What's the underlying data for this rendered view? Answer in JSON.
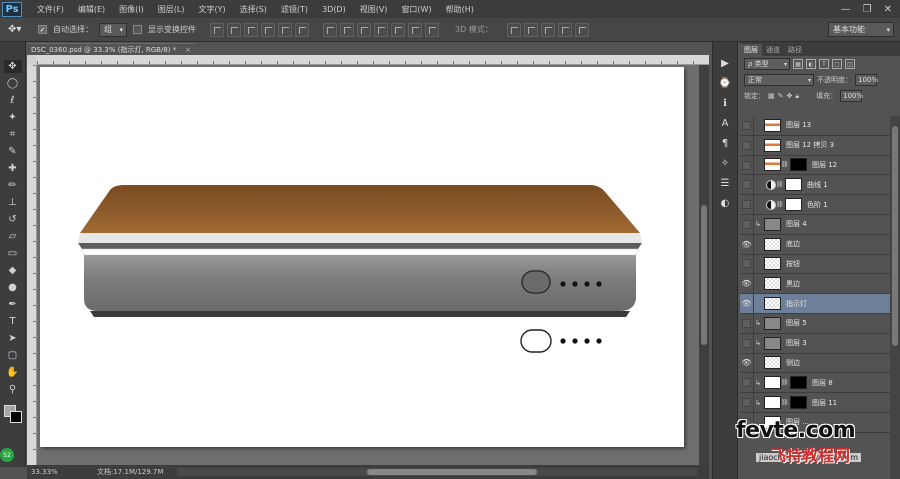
{
  "app": {
    "logo": "Ps"
  },
  "menu": [
    "文件(F)",
    "编辑(E)",
    "图像(I)",
    "图层(L)",
    "文字(Y)",
    "选择(S)",
    "滤镜(T)",
    "3D(D)",
    "视图(V)",
    "窗口(W)",
    "帮助(H)"
  ],
  "window_controls": {
    "minimize": "—",
    "restore": "❐",
    "close": "✕"
  },
  "options": {
    "auto_select_label": "自动选择：",
    "auto_select_checked": true,
    "auto_select_value": "组",
    "show_transform_label": "显示变换控件",
    "show_transform_checked": false,
    "mode_3d_label": "3D 模式：",
    "workspace": "基本功能"
  },
  "document": {
    "tab_title": "DSC_0360.psd @ 33.3% (指示灯, RGB/8) *",
    "tab_close": "×"
  },
  "status": {
    "zoom": "33.33%",
    "doc_size": "文档:17.1M/129.7M"
  },
  "tools_badge": "52",
  "layers_panel": {
    "tabs": [
      "图层",
      "通道",
      "路径"
    ],
    "filter_kind": "ρ 类型",
    "blend_mode": "正常",
    "opacity_label": "不透明度：",
    "opacity_value": "100%",
    "lock_label": "锁定：",
    "fill_label": "填充：",
    "fill_value": "100%",
    "layers": [
      {
        "name": "图层 13",
        "visible": false,
        "clip": false,
        "thumb": "orange",
        "mask": null,
        "selected": false
      },
      {
        "name": "图层 12 拷贝 3",
        "visible": false,
        "clip": false,
        "thumb": "orange",
        "mask": null,
        "selected": false
      },
      {
        "name": "图层 12",
        "visible": false,
        "clip": false,
        "thumb": "orange",
        "mask": "black",
        "selected": false
      },
      {
        "name": "曲线 1",
        "visible": false,
        "clip": false,
        "thumb": "adjustment",
        "mask": "white",
        "selected": false
      },
      {
        "name": "色阶 1",
        "visible": false,
        "clip": false,
        "thumb": "adjustment",
        "mask": "white",
        "selected": false
      },
      {
        "name": "图层 4",
        "visible": false,
        "clip": true,
        "thumb": "gray",
        "mask": null,
        "selected": false
      },
      {
        "name": "底边",
        "visible": true,
        "clip": false,
        "thumb": "checker",
        "mask": null,
        "selected": false
      },
      {
        "name": "按钮",
        "visible": false,
        "clip": false,
        "thumb": "checker",
        "mask": null,
        "selected": false
      },
      {
        "name": "黑边",
        "visible": true,
        "clip": false,
        "thumb": "checker",
        "mask": null,
        "selected": false
      },
      {
        "name": "指示灯",
        "visible": true,
        "clip": false,
        "thumb": "checker",
        "mask": null,
        "selected": true
      },
      {
        "name": "图层 5",
        "visible": false,
        "clip": true,
        "thumb": "gray",
        "mask": null,
        "selected": false
      },
      {
        "name": "图层 3",
        "visible": false,
        "clip": true,
        "thumb": "gray",
        "mask": null,
        "selected": false
      },
      {
        "name": "侧边",
        "visible": true,
        "clip": false,
        "thumb": "checker",
        "mask": null,
        "selected": false
      },
      {
        "name": "图层 8",
        "visible": false,
        "clip": true,
        "thumb": "white",
        "mask": "black",
        "selected": false
      },
      {
        "name": "图层 11",
        "visible": false,
        "clip": true,
        "thumb": "white",
        "mask": "black",
        "selected": false
      },
      {
        "name": "图层 ...",
        "visible": false,
        "clip": false,
        "thumb": "white",
        "mask": null,
        "selected": false
      }
    ]
  },
  "colors": {
    "accent_selected": "#6e7f99",
    "power_bank_top": "#8b5a2b",
    "power_bank_body": "#7c7c7c"
  },
  "watermark": {
    "main": "fevte.com",
    "sub": "jiaocheng.chazidian.com",
    "cn": "飞特教程网"
  }
}
